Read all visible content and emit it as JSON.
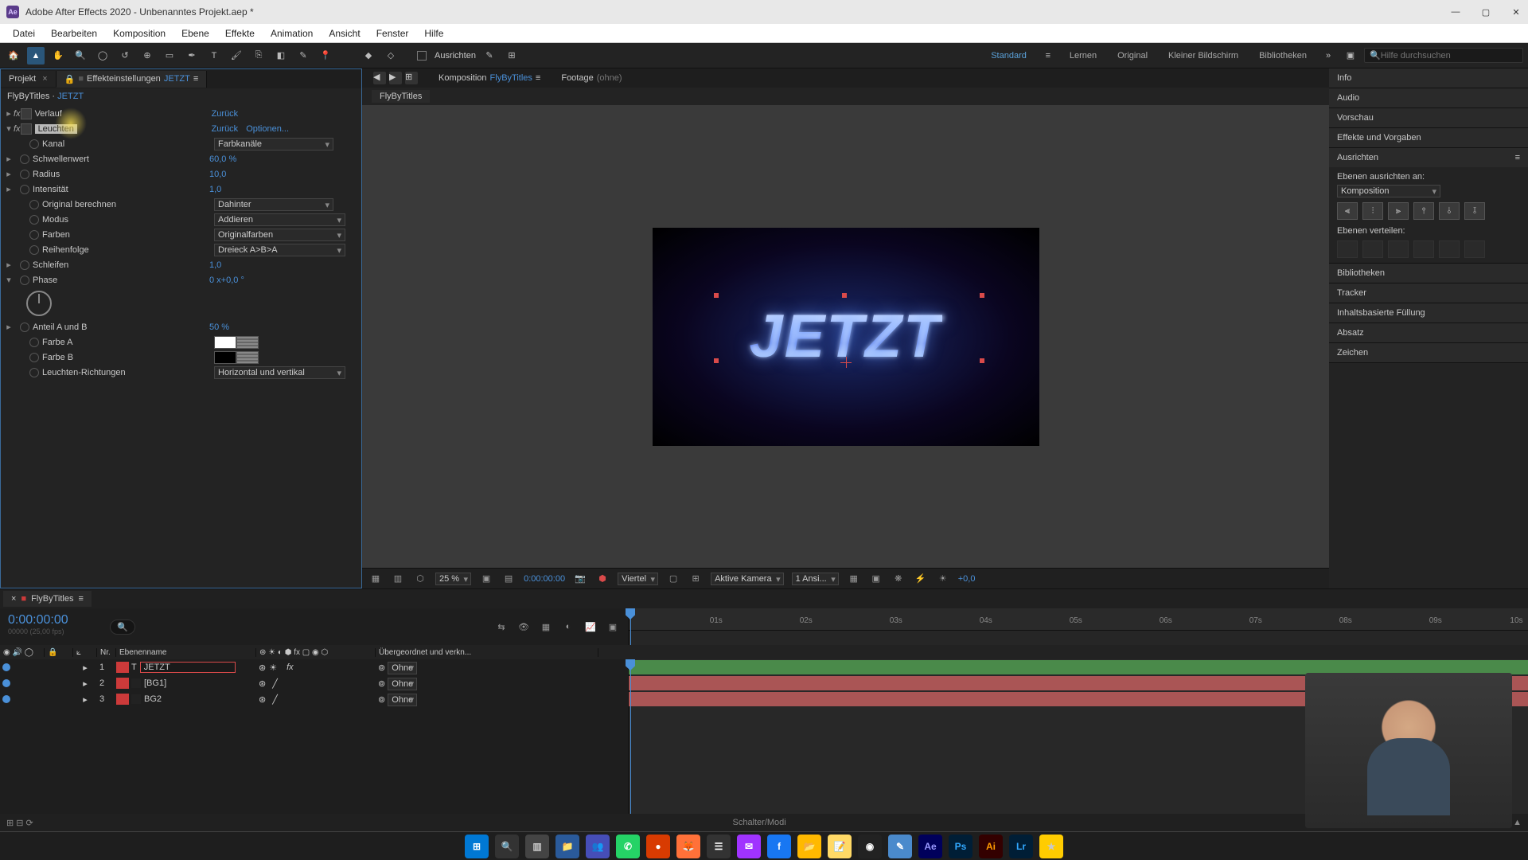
{
  "titlebar": {
    "app": "Ae",
    "title": "Adobe After Effects 2020 - Unbenanntes Projekt.aep *"
  },
  "menu": [
    "Datei",
    "Bearbeiten",
    "Komposition",
    "Ebene",
    "Effekte",
    "Animation",
    "Ansicht",
    "Fenster",
    "Hilfe"
  ],
  "toolbar": {
    "ausrichten": "Ausrichten",
    "workspaces": {
      "active": "Standard",
      "items": [
        "Lernen",
        "Original",
        "Kleiner Bildschirm",
        "Bibliotheken"
      ]
    },
    "search_placeholder": "Hilfe durchsuchen"
  },
  "left": {
    "tabs": {
      "projekt": "Projekt",
      "effekt": "Effekteinstellungen",
      "layer": "JETZT"
    },
    "breadcrumb_comp": "FlyByTitles",
    "breadcrumb_sep": " · ",
    "breadcrumb_layer": "JETZT",
    "fx1": {
      "name": "Verlauf",
      "reset": "Zurück"
    },
    "fx2": {
      "name": "Leuchten",
      "reset": "Zurück",
      "opts": "Optionen..."
    },
    "props": {
      "kanal": {
        "label": "Kanal",
        "value": "Farbkanäle"
      },
      "schwelle": {
        "label": "Schwellenwert",
        "value": "60,0 %"
      },
      "radius": {
        "label": "Radius",
        "value": "10,0"
      },
      "intens": {
        "label": "Intensität",
        "value": "1,0"
      },
      "orig": {
        "label": "Original berechnen",
        "value": "Dahinter"
      },
      "modus": {
        "label": "Modus",
        "value": "Addieren"
      },
      "farben": {
        "label": "Farben",
        "value": "Originalfarben"
      },
      "reihen": {
        "label": "Reihenfolge",
        "value": "Dreieck A>B>A"
      },
      "schleifen": {
        "label": "Schleifen",
        "value": "1,0"
      },
      "phase": {
        "label": "Phase",
        "value": "0 x+0,0 °"
      },
      "anteil": {
        "label": "Anteil A und B",
        "value": "50 %"
      },
      "farbea": {
        "label": "Farbe A"
      },
      "farbeb": {
        "label": "Farbe B"
      },
      "richt": {
        "label": "Leuchten-Richtungen",
        "value": "Horizontal und vertikal"
      }
    }
  },
  "center": {
    "tabs": {
      "komposition_label": "Komposition",
      "komposition_name": "FlyByTitles",
      "footage": "Footage",
      "footage_none": "(ohne)"
    },
    "subtab": "FlyByTitles",
    "canvas_text": "JETZT",
    "footer": {
      "mag": "25 %",
      "time": "0:00:00:00",
      "res": "Viertel",
      "camera": "Aktive Kamera",
      "views": "1 Ansi...",
      "exposure": "+0,0"
    }
  },
  "right": {
    "panels": [
      "Info",
      "Audio",
      "Vorschau",
      "Effekte und Vorgaben"
    ],
    "align": {
      "title": "Ausrichten",
      "sublabel": "Ebenen ausrichten an:",
      "target": "Komposition",
      "distribute": "Ebenen verteilen:"
    },
    "more": [
      "Bibliotheken",
      "Tracker",
      "Inhaltsbasierte Füllung",
      "Absatz",
      "Zeichen"
    ]
  },
  "timeline": {
    "tab": "FlyByTitles",
    "timecode": "0:00:00:00",
    "fps": "00000 (25,00 fps)",
    "cols": {
      "nr": "Nr.",
      "name": "Ebenenname",
      "parent": "Übergeordnet und verkn..."
    },
    "layers": [
      {
        "num": "1",
        "name": "JETZT",
        "type": "T",
        "parent": "Ohne",
        "selected": true,
        "color": "#cc3a3a"
      },
      {
        "num": "2",
        "name": "[BG1]",
        "type": "S",
        "parent": "Ohne",
        "selected": false,
        "color": "#cc3a3a"
      },
      {
        "num": "3",
        "name": "BG2",
        "type": "S",
        "parent": "Ohne",
        "selected": false,
        "color": "#cc3a3a"
      }
    ],
    "ruler": [
      "01s",
      "02s",
      "03s",
      "04s",
      "05s",
      "06s",
      "07s",
      "08s",
      "09s",
      "10s"
    ],
    "footer_mode": "Schalter/Modi"
  },
  "taskbar": [
    "win",
    "search",
    "tasks",
    "explorer",
    "teams",
    "whatsapp",
    "todo",
    "firefox",
    "app1",
    "messenger",
    "facebook",
    "files",
    "notes",
    "obs",
    "editor",
    "AE",
    "PS",
    "AI",
    "LR",
    "extra"
  ]
}
